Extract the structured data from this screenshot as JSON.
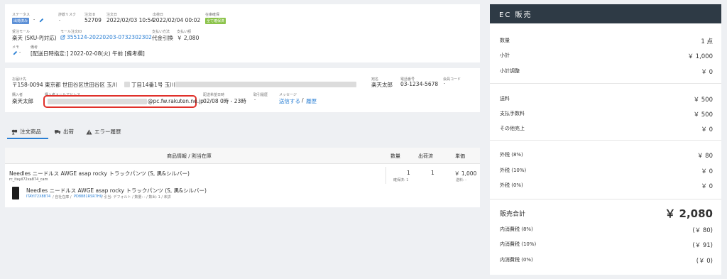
{
  "order": {
    "labels": {
      "status": "ステータス",
      "risk": "詐欺リスク",
      "order_id": "注文ID",
      "order_date": "注文日",
      "ship_date": "出荷日",
      "stock": "在庫確保",
      "channel": "受注モール",
      "mall_order_id": "モール注文ID",
      "payment": "支払い方法",
      "amount": "支払い額",
      "memo": "メモ",
      "remarks": "備考"
    },
    "status_badge": "出荷済み",
    "status_dash": "-",
    "risk": "-",
    "order_id": "52709",
    "order_date": "2022/02/03 10:54",
    "ship_date": "2022/02/04 00:02",
    "stock_badge": "全て確保済",
    "channel": "楽天 (SKU-PJ対応)",
    "mall_order_id": "355124-20220203-0732302302",
    "payment": "代金引換",
    "amount": "￥ 2,080",
    "memo": "-",
    "remarks": "[配送日時指定:] 2022-02-08(火) 午前 [備考欄]"
  },
  "delivery": {
    "labels": {
      "address": "お届け先",
      "buyer": "購入者",
      "buyer_email": "購入者メールアドレス",
      "desired_time": "配送希望日時",
      "history": "取引履歴",
      "message": "メッセージ",
      "name": "宛名",
      "phone": "電話番号",
      "member_code": "会員コード"
    },
    "address": "〒158-0094 東京都 世田谷区世田谷区 玉川",
    "address_2": "丁目14番1号 玉川",
    "buyer": "楽天太郎",
    "email_domain": "@pc.fw.rakuten.ne.jp",
    "desired_time": "02/08 0時 - 23時",
    "history": "-",
    "message_send": "送信する",
    "message_sep": "/",
    "message_history": "履歴",
    "name": "楽天太郎",
    "phone": "03-1234-5678",
    "member_code": "-"
  },
  "tabs": [
    {
      "label": "注文商品",
      "icon": "items-icon"
    },
    {
      "label": "出荷",
      "icon": "truck-icon"
    },
    {
      "label": "エラー履歴",
      "icon": "warning-icon"
    }
  ],
  "table": {
    "headers": {
      "product": "商品情報 / 割当在庫",
      "qty": "数量",
      "shipped": "出荷済",
      "price": "単価"
    },
    "row": {
      "title": "Needles ニードルス AWGE asap rocky トラックパンツ (S, 黒&シルバー)",
      "code": "rc_itayil72xa874_cam",
      "qty": "1",
      "qty_note": "確保済: 1",
      "shipped": "1",
      "price": "￥ 1,000",
      "price_note": "送料: -"
    },
    "stock": {
      "title": "Needles ニードルス AWGE asap rocky トラックパンツ (S, 黒&シルバー)",
      "sku": "ITAYI72X8874",
      "location": "/ 自社在庫 /",
      "lot": "PD8881RSR7HU",
      "rest": "/ 引当: デフォルト / 数量: - / 数出: 1 / 未詳"
    }
  },
  "ec": {
    "title": "EC 販売",
    "rows": [
      {
        "label": "数量",
        "value": "1 点"
      },
      {
        "label": "小計",
        "value": "￥ 1,000"
      },
      {
        "label": "小計調整",
        "value": "￥ 0"
      },
      {
        "label": "送料",
        "value": "￥ 500"
      },
      {
        "label": "支払手数料",
        "value": "￥ 500"
      },
      {
        "label": "その他売上",
        "value": "￥ 0"
      },
      {
        "label": "外税 (8%)",
        "value": "￥ 80"
      },
      {
        "label": "外税 (10%)",
        "value": "￥ 0"
      },
      {
        "label": "外税 (0%)",
        "value": "￥ 0"
      }
    ],
    "total_label": "販売合計",
    "total_value": "￥ 2,080",
    "inner": [
      {
        "label": "内消費税 (8%)",
        "value": "(￥ 80)"
      },
      {
        "label": "内消費税 (10%)",
        "value": "(￥ 91)"
      },
      {
        "label": "内消費税 (0%)",
        "value": "(￥ 0)"
      }
    ]
  },
  "colors": {
    "accent": "#2a7fd4",
    "badge_blue": "#5b8fd6",
    "badge_green": "#8bc34a",
    "highlight": "#e0302a",
    "ec_header": "#2e3a45"
  }
}
